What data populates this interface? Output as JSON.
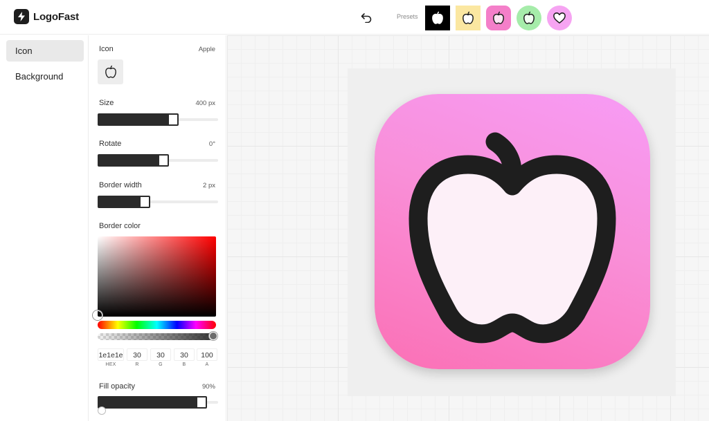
{
  "app": {
    "name": "LogoFast"
  },
  "header": {
    "presets_label": "Presets",
    "presets": [
      {
        "bg": "#000000",
        "icon_color": "#ffffff",
        "icon": "apple-icon"
      },
      {
        "bg": "#fbe7a1",
        "icon_color": "#1e1e1e",
        "icon": "apple-icon"
      },
      {
        "bg": "#f47fc9",
        "icon_color": "#1e1e1e",
        "icon": "apple-icon"
      },
      {
        "bg": "#a6ecaa",
        "icon_color": "#1e1e1e",
        "icon": "apple-icon"
      },
      {
        "bg": "#f6a4f2",
        "icon_color": "#1e1e1e",
        "icon": "heart-icon"
      }
    ]
  },
  "nav": {
    "items": [
      {
        "label": "Icon",
        "active": true
      },
      {
        "label": "Background",
        "active": false
      }
    ]
  },
  "panel": {
    "icon": {
      "label": "Icon",
      "value": "Apple"
    },
    "size": {
      "label": "Size",
      "value": "400 px",
      "fraction": 0.64
    },
    "rotate": {
      "label": "Rotate",
      "value": "0°",
      "fraction": 0.55
    },
    "border_width": {
      "label": "Border width",
      "value": "2 px",
      "fraction": 0.38
    },
    "border_color": {
      "label": "Border color",
      "hex": "1e1e1e",
      "r": "30",
      "g": "30",
      "b": "30",
      "a": "100",
      "hex_label": "HEX",
      "r_label": "R",
      "g_label": "G",
      "b_label": "B",
      "a_label": "A"
    },
    "fill_opacity": {
      "label": "Fill opacity",
      "value": "90%",
      "fraction": 0.9
    }
  },
  "preview": {
    "background": "#f98fd8",
    "icon": "apple-icon",
    "border_color": "#1e1e1e",
    "fill_color": "#fdf0f8"
  }
}
